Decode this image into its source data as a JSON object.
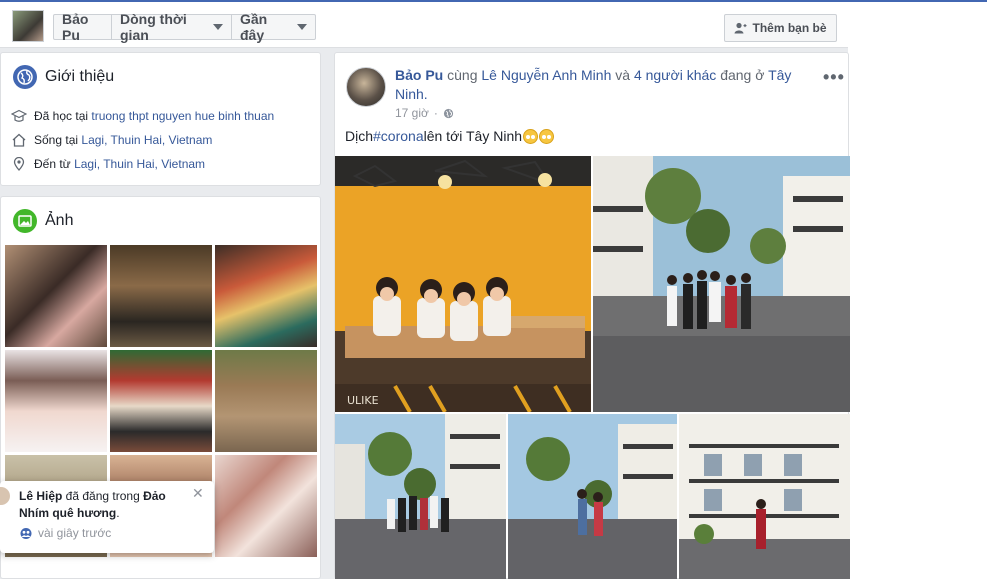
{
  "header": {
    "name_tab": "Bảo Pu",
    "timeline_tab": "Dòng thời gian",
    "recent_tab": "Gần đây",
    "add_friend": "Thêm bạn bè"
  },
  "intro": {
    "title": "Giới thiệu",
    "studied_prefix": "Đã học tại ",
    "studied_value": "truong thpt nguyen hue binh thuan",
    "lives_prefix": "Sống tại ",
    "lives_value": "Lagi, Thuin Hai, Vietnam",
    "from_prefix": "Đến từ ",
    "from_value": "Lagi, Thuin Hai, Vietnam"
  },
  "photos": {
    "title": "Ảnh"
  },
  "post": {
    "author": "Bảo Pu",
    "with_word": " cùng ",
    "tagged_1": "Lê Nguyễn Anh Minh",
    "and_word": " và ",
    "others": "4 người khác",
    "location_word": " đang ở ",
    "location": "Tây Ninh",
    "location_end": ".",
    "time": "17 giờ",
    "more": "•••",
    "text_before": "Dịch ",
    "hashtag": "#corona",
    "text_after": " lên tới Tây Ninh"
  },
  "notification": {
    "actor": "Lê Hiệp",
    "action": " đã đăng trong ",
    "group": "Đảo Nhím quê hương",
    "end": ".",
    "time": "vài giây trước",
    "close": "✕"
  },
  "cafe_sign": "ULIKE",
  "colors": {
    "brand_blue": "#4267b2",
    "link": "#365899",
    "background": "#e9ebee"
  }
}
